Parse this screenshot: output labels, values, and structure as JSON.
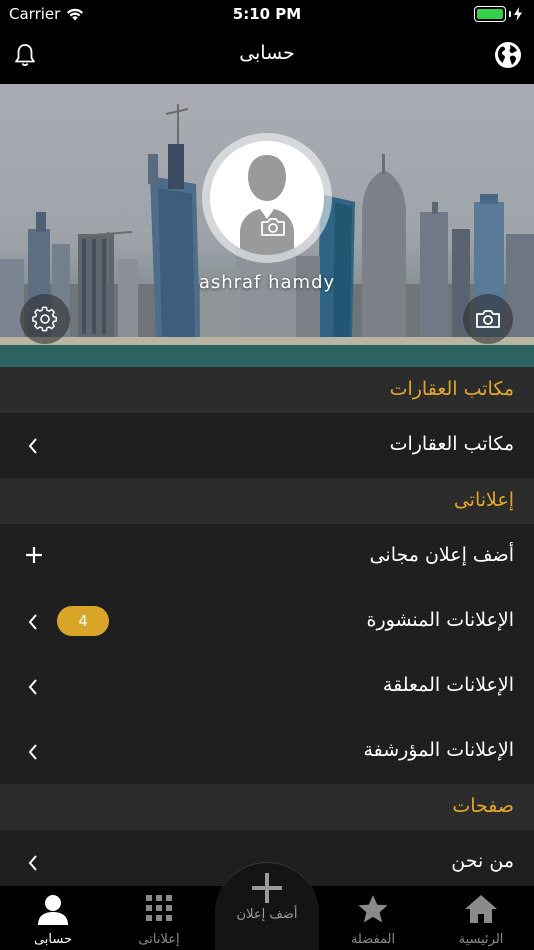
{
  "status_bar": {
    "carrier": "Carrier",
    "time": "5:10 PM",
    "battery_level": 1.0
  },
  "nav": {
    "title": "حسابى"
  },
  "profile": {
    "name": "ashraf hamdy"
  },
  "sections": {
    "offices": {
      "header": "مكاتب العقارات",
      "row": "مكاتب العقارات"
    },
    "my_ads": {
      "header": "إعلاناتى",
      "add_free": "أضف إعلان مجانى",
      "published": "الإعلانات المنشورة",
      "published_count": "4",
      "pending": "الإعلانات المعلقة",
      "archived": "الإعلانات المؤرشفة"
    },
    "pages": {
      "header": "صفحات",
      "about": "من نحن"
    }
  },
  "tabbar": {
    "account": "حسابى",
    "my_ads": "إعلاناتى",
    "add_ad": "أضف إعلان",
    "favorites": "المفضلة",
    "home": "الرئيسية"
  },
  "colors": {
    "accent": "#e3a82b",
    "badge": "#d8a526",
    "background": "#1f1f1f",
    "section": "#2c2c2c"
  }
}
